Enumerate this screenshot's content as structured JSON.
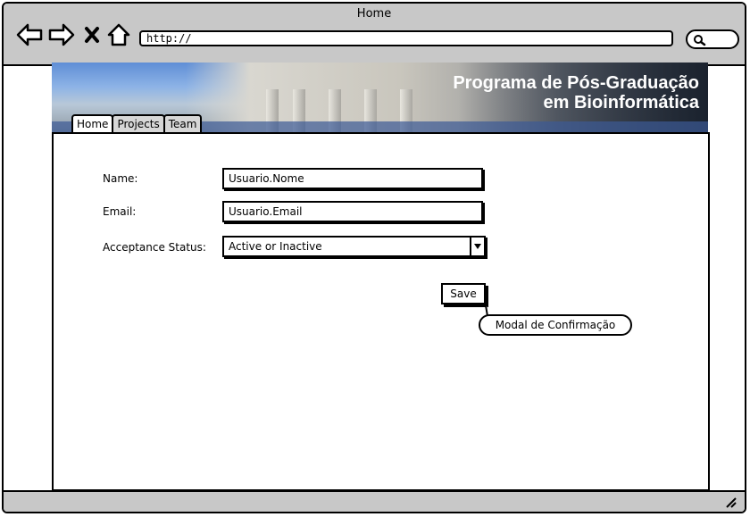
{
  "window": {
    "title": "Home"
  },
  "browser": {
    "url": "http://",
    "icons": {
      "back": "arrow-left-icon",
      "forward": "arrow-right-icon",
      "stop": "close-icon",
      "home": "home-icon",
      "search": "search-icon",
      "resize": "resize-grip-icon"
    }
  },
  "header": {
    "line1": "Programa de Pós-Graduação",
    "line2": "em Bioinformática"
  },
  "tabs": [
    {
      "label": "Home",
      "active": true
    },
    {
      "label": "Projects",
      "active": false
    },
    {
      "label": "Team",
      "active": false
    }
  ],
  "form": {
    "name_label": "Name:",
    "name_value": "Usuario.Nome",
    "email_label": "Email:",
    "email_value": "Usuario.Email",
    "status_label": "Acceptance Status:",
    "status_value": "Active or Inactive",
    "save_label": "Save"
  },
  "annotation": {
    "text": "Modal de Confirmação"
  }
}
